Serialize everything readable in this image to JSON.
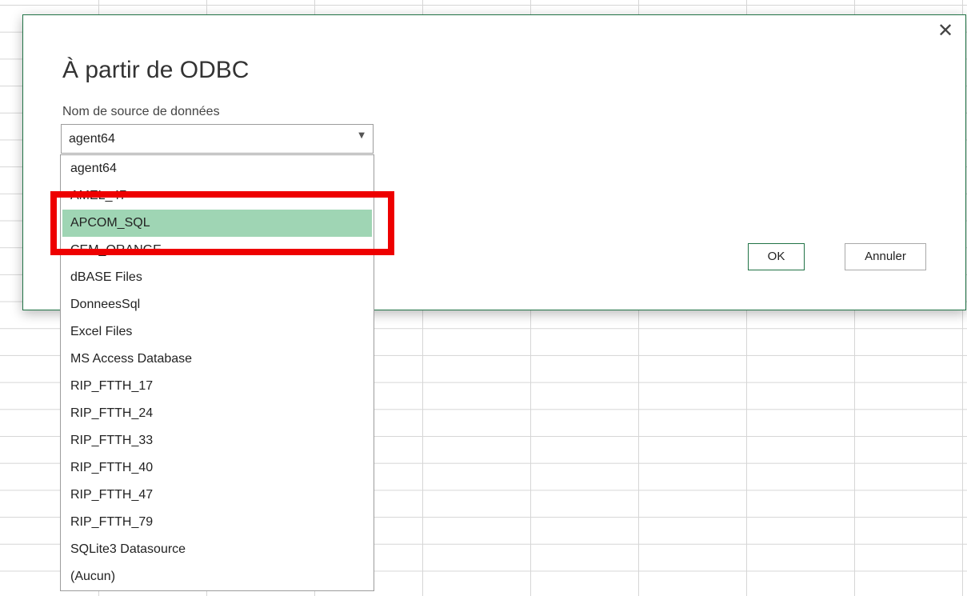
{
  "dialog": {
    "title": "À partir de ODBC",
    "close_icon": "close-icon",
    "field_label": "Nom de source de données",
    "selected_value": "agent64",
    "caret_icon": "chevron-down-icon",
    "ok_label": "OK",
    "cancel_label": "Annuler"
  },
  "dropdown": {
    "options": [
      "agent64",
      "AMEL_47",
      "APCOM_SQL",
      "CEM_ORANGE",
      "dBASE Files",
      "DonneesSql",
      "Excel Files",
      "MS Access Database",
      "RIP_FTTH_17",
      "RIP_FTTH_24",
      "RIP_FTTH_33",
      "RIP_FTTH_40",
      "RIP_FTTH_47",
      "RIP_FTTH_79",
      "SQLite3 Datasource",
      "(Aucun)"
    ],
    "hovered_option": "APCOM_SQL"
  },
  "colors": {
    "accent": "#217346",
    "hover_highlight": "#9fd5b4",
    "annotation": "#ee0000"
  }
}
